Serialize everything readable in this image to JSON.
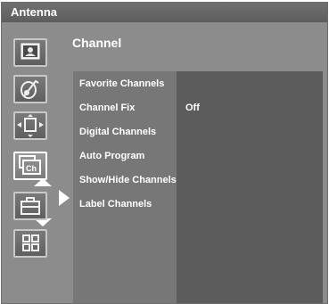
{
  "window": {
    "title": "Antenna"
  },
  "section": {
    "title": "Channel"
  },
  "sidebar": {
    "icons": [
      {
        "name": "picture-icon",
        "active": false
      },
      {
        "name": "sound-icon",
        "active": false
      },
      {
        "name": "screen-adjust-icon",
        "active": false
      },
      {
        "name": "channel-icon",
        "active": true,
        "label": "Ch"
      },
      {
        "name": "toolbox-icon",
        "active": false
      },
      {
        "name": "apps-icon",
        "active": false
      }
    ]
  },
  "menu": {
    "items": [
      {
        "label": "Favorite Channels",
        "value": ""
      },
      {
        "label": "Channel Fix",
        "value": "Off"
      },
      {
        "label": "Digital Channels",
        "value": ""
      },
      {
        "label": "Auto Program",
        "value": ""
      },
      {
        "label": "Show/Hide Channels",
        "value": ""
      },
      {
        "label": "Label Channels",
        "value": ""
      }
    ]
  },
  "colors": {
    "panel": "#8c8c8c",
    "titlebar": "#666666",
    "menu_left": "#777777",
    "menu_right": "#5c5c5c",
    "text": "#ffffff"
  }
}
